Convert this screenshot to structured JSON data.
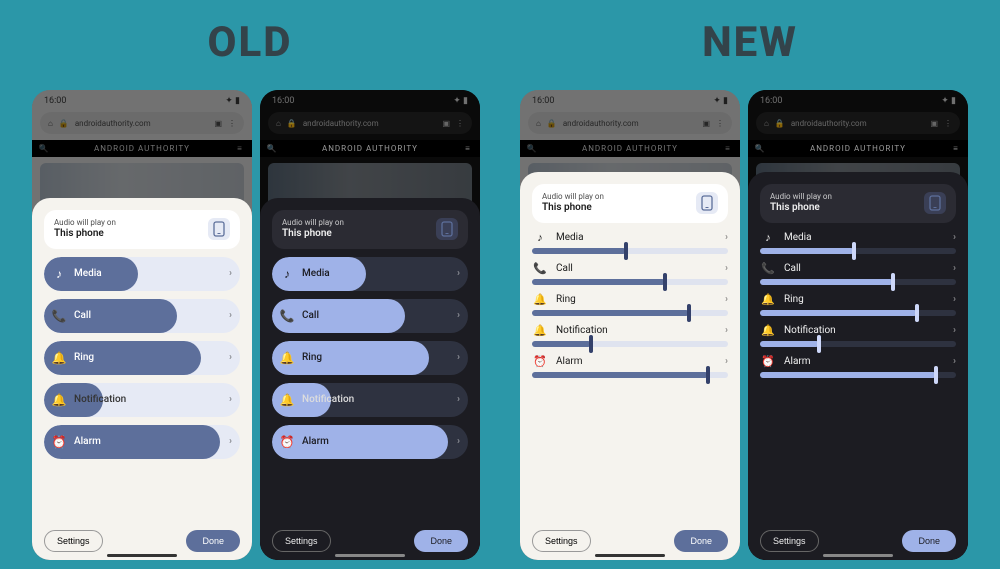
{
  "labels": {
    "old": "OLD",
    "new": "NEW"
  },
  "status": {
    "time": "16:00"
  },
  "url": {
    "domain": "androidauthority.com"
  },
  "banner": {
    "brand": "ANDROID AUTHORITY"
  },
  "cast": {
    "sub": "Audio will play on",
    "main": "This phone"
  },
  "channels": [
    {
      "key": "media",
      "label": "Media",
      "icon": "♪",
      "level": 48
    },
    {
      "key": "call",
      "label": "Call",
      "icon": "📞",
      "level": 68
    },
    {
      "key": "ring",
      "label": "Ring",
      "icon": "🔔",
      "level": 80
    },
    {
      "key": "notification",
      "label": "Notification",
      "icon": "🔔",
      "level": 30
    },
    {
      "key": "alarm",
      "label": "Alarm",
      "icon": "⏰",
      "level": 90
    }
  ],
  "buttons": {
    "settings": "Settings",
    "done": "Done"
  }
}
